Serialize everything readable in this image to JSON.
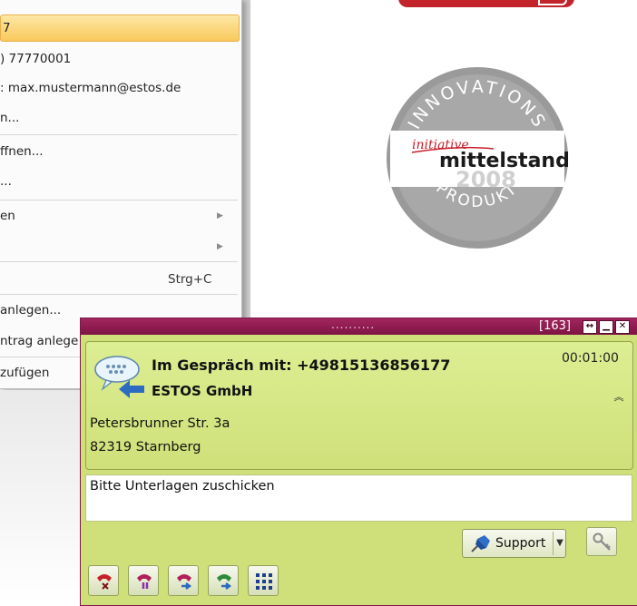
{
  "context_menu": {
    "items": [
      {
        "label": "7",
        "highlighted": true
      },
      {
        "label": ") 77770001"
      },
      {
        "label": ": max.mustermann@estos.de"
      },
      {
        "label": "n..."
      },
      {
        "label": "ffnen..."
      },
      {
        "label": "..."
      },
      {
        "label": "en",
        "submenu": true
      },
      {
        "label": "",
        "submenu": true
      },
      {
        "label": "",
        "shortcut": "Strg+C"
      },
      {
        "label": "anlegen..."
      },
      {
        "label": "ntrag anlege"
      },
      {
        "label": "zufügen"
      }
    ]
  },
  "badge": {
    "top_text": "INNOVATIONS",
    "script_text": "initiative",
    "name": "mittelstand",
    "year": "2008",
    "bottom_text": "PRODUKT"
  },
  "call_window": {
    "title_dots": "..........",
    "count": "[163]",
    "call_title": "Im Gespräch mit: +49815136856177",
    "company": "ESTOS GmbH",
    "timer": "00:01:00",
    "address_line1": "Petersbrunner Str. 3a",
    "address_line2": "82319 Starnberg",
    "note": "Bitte Unterlagen zuschicken",
    "support_label": "Support",
    "colors": {
      "titlebar": "#8a1a4f",
      "panel": "#cfe07a"
    },
    "icons": [
      "hangup-icon",
      "hold-icon",
      "transfer-icon",
      "connect-transfer-icon",
      "dialpad-icon"
    ]
  }
}
